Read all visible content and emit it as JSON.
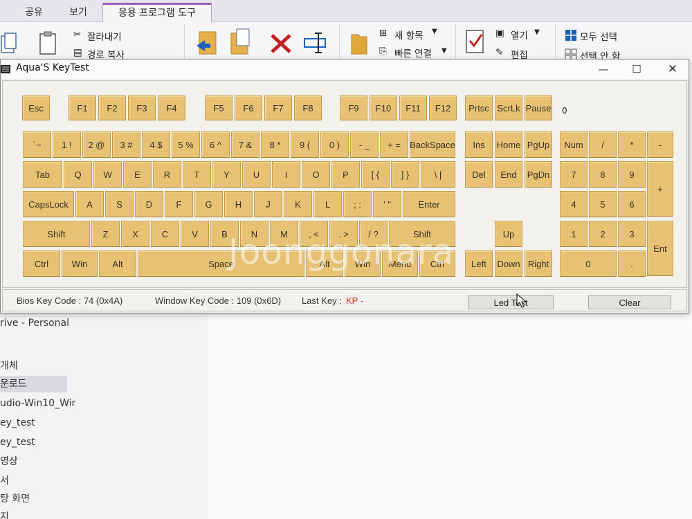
{
  "explorer": {
    "tabs": [
      "공유",
      "보기",
      "응용 프로그램 도구"
    ],
    "ribbon": {
      "cut": "잘라내기",
      "copy_path": "경로 복사",
      "new_item": "새 항목",
      "easy_access": "빠른 연결",
      "open": "열기",
      "edit": "편집",
      "select_all": "모두 선택",
      "select_none": "선택 안 함"
    },
    "nav_items": [
      "rive - Personal",
      "",
      "개체",
      "운로드",
      "udio-Win10_Wir",
      "ey_test",
      "ey_test",
      "영상",
      "서",
      "탕 화면",
      "지"
    ]
  },
  "keytest": {
    "title": "Aqua'S KeyTest",
    "window_buttons": {
      "minimize": "—",
      "maximize": "☐",
      "close": "✕"
    },
    "led_indicator": "0",
    "keys": {
      "esc": "Esc",
      "f1": "F1",
      "f2": "F2",
      "f3": "F3",
      "f4": "F4",
      "f5": "F5",
      "f6": "F6",
      "f7": "F7",
      "f8": "F8",
      "f9": "F9",
      "f10": "F10",
      "f11": "F11",
      "f12": "F12",
      "prtsc": "Prtsc",
      "scrlk": "ScrLk",
      "pause": "Pause",
      "backtick": "`~",
      "d1": "1 !",
      "d2": "2 @",
      "d3": "3 #",
      "d4": "4 $",
      "d5": "5 %",
      "d6": "6 ^",
      "d7": "7 &",
      "d8": "8 *",
      "d9": "9 (",
      "d0": "0 )",
      "minus": "- _",
      "equals": "+ =",
      "backspace": "BackSpace",
      "ins": "Ins",
      "home": "Home",
      "pgup": "PgUp",
      "num": "Num",
      "np_div": "/",
      "np_mul": "*",
      "np_sub": "-",
      "tab": "Tab",
      "q": "Q",
      "w": "W",
      "e": "E",
      "r": "R",
      "t": "T",
      "y": "Y",
      "u": "U",
      "i": "I",
      "o": "O",
      "p": "P",
      "lbracket": "[ {",
      "rbracket": "] }",
      "backslash": "\\ |",
      "del": "Del",
      "end": "End",
      "pgdn": "PgDn",
      "np7": "7",
      "np8": "8",
      "np9": "9",
      "np_add": "+",
      "capslock": "CapsLock",
      "a": "A",
      "s": "S",
      "d": "D",
      "f": "F",
      "g": "G",
      "h": "H",
      "j": "J",
      "k": "K",
      "l": "L",
      "semicolon": "; :",
      "quote": "' \"",
      "enter": "Enter",
      "np4": "4",
      "np5": "5",
      "np6": "6",
      "lshift": "Shift",
      "z": "Z",
      "x": "X",
      "c": "C",
      "v": "V",
      "b": "B",
      "n": "N",
      "m": "M",
      "comma": ", <",
      "period": ". >",
      "slash": "/ ?",
      "rshift": "Shift",
      "up": "Up",
      "np1": "1",
      "np2": "2",
      "np3": "3",
      "np_enter": "Ent",
      "lctrl": "Ctrl",
      "lwin": "Win",
      "lalt": "Alt",
      "space": "Space",
      "ralt": "Alt",
      "rwin": "Win",
      "menu": "Menu",
      "rctrl": "Ctrl",
      "left": "Left",
      "down": "Down",
      "right": "Right",
      "np0": "0",
      "np_dot": "."
    },
    "status": {
      "bios_key_code": "Bios Key Code : 74 (0x4A)",
      "window_key_code": "Window Key Code : 109 (0x6D)",
      "last_key_label": "Last Key :",
      "last_key_value": "KP -",
      "led_test_button": "Led Test",
      "clear_button": "Clear"
    }
  },
  "watermark": "Joonggonara",
  "colors": {
    "key": "#e7c275",
    "key_border": "#c49a45",
    "accent_tab": "#a45ab8",
    "last_key": "#d32a2a"
  }
}
